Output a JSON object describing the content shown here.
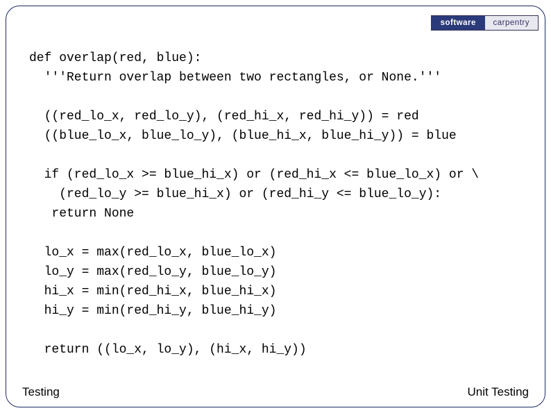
{
  "logo": {
    "left": "software",
    "right": "carpentry"
  },
  "code": "def overlap(red, blue):\n  '''Return overlap between two rectangles, or None.'''\n\n  ((red_lo_x, red_lo_y), (red_hi_x, red_hi_y)) = red\n  ((blue_lo_x, blue_lo_y), (blue_hi_x, blue_hi_y)) = blue\n\n  if (red_lo_x >= blue_hi_x) or (red_hi_x <= blue_lo_x) or \\\n    (red_lo_y >= blue_hi_x) or (red_hi_y <= blue_lo_y):\n   return None\n\n  lo_x = max(red_lo_x, blue_lo_x)\n  lo_y = max(red_lo_y, blue_lo_y)\n  hi_x = min(red_hi_x, blue_hi_x)\n  hi_y = min(red_hi_y, blue_hi_y)\n\n  return ((lo_x, lo_y), (hi_x, hi_y))",
  "footer": {
    "left": "Testing",
    "right": "Unit Testing"
  }
}
